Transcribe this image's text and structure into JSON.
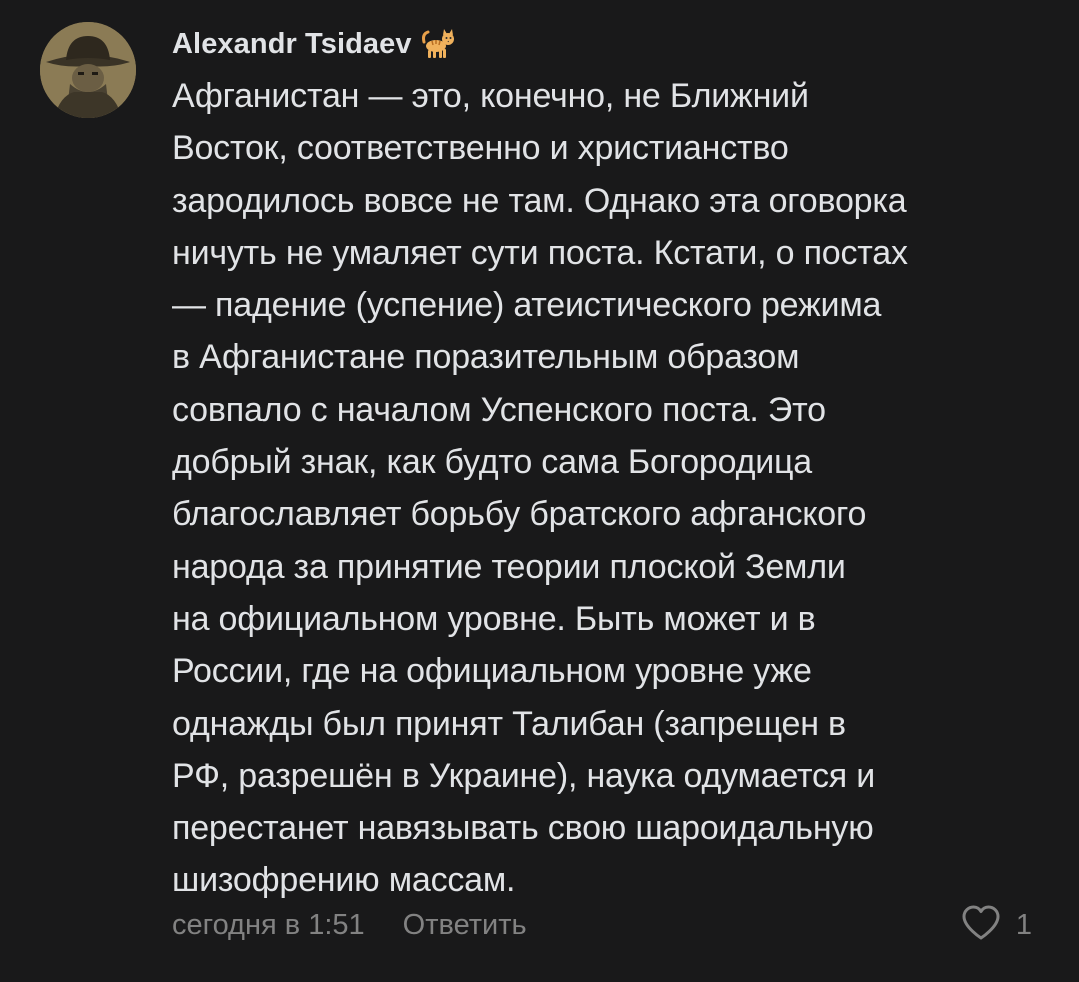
{
  "comment": {
    "author": "Alexandr Tsidaev",
    "author_badge_icon": "cat-emoji",
    "text": "Афганистан — это, конечно, не Ближний\nВосток, соответственно и христианство\nзародилось вовсе не там. Однако эта оговорка\nничуть не умаляет сути поста. Кстати, о постах\n— падение (успение) атеистического режима\nв Афганистане поразительным образом\nсовпало с началом Успенского поста. Это\nдобрый знак, как будто сама Богородица\nблагославляет борьбу братского афганского\nнарода за принятие теории плоской Земли\nна официальном уровне. Быть может и в\nРоссии, где на официальном уровне уже\nоднажды был принят Талибан (запрещен в\nРФ, разрешён в Украине), наука одумается и\nперестанет навязывать свою шароидальную\nшизофрению массам.",
    "timestamp": "сегодня в 1:51",
    "reply_label": "Ответить",
    "like_icon": "heart-outline-icon",
    "like_count": "1"
  },
  "colors": {
    "background": "#19191a",
    "text_primary": "#e1e3e6",
    "text_secondary": "#828282"
  }
}
